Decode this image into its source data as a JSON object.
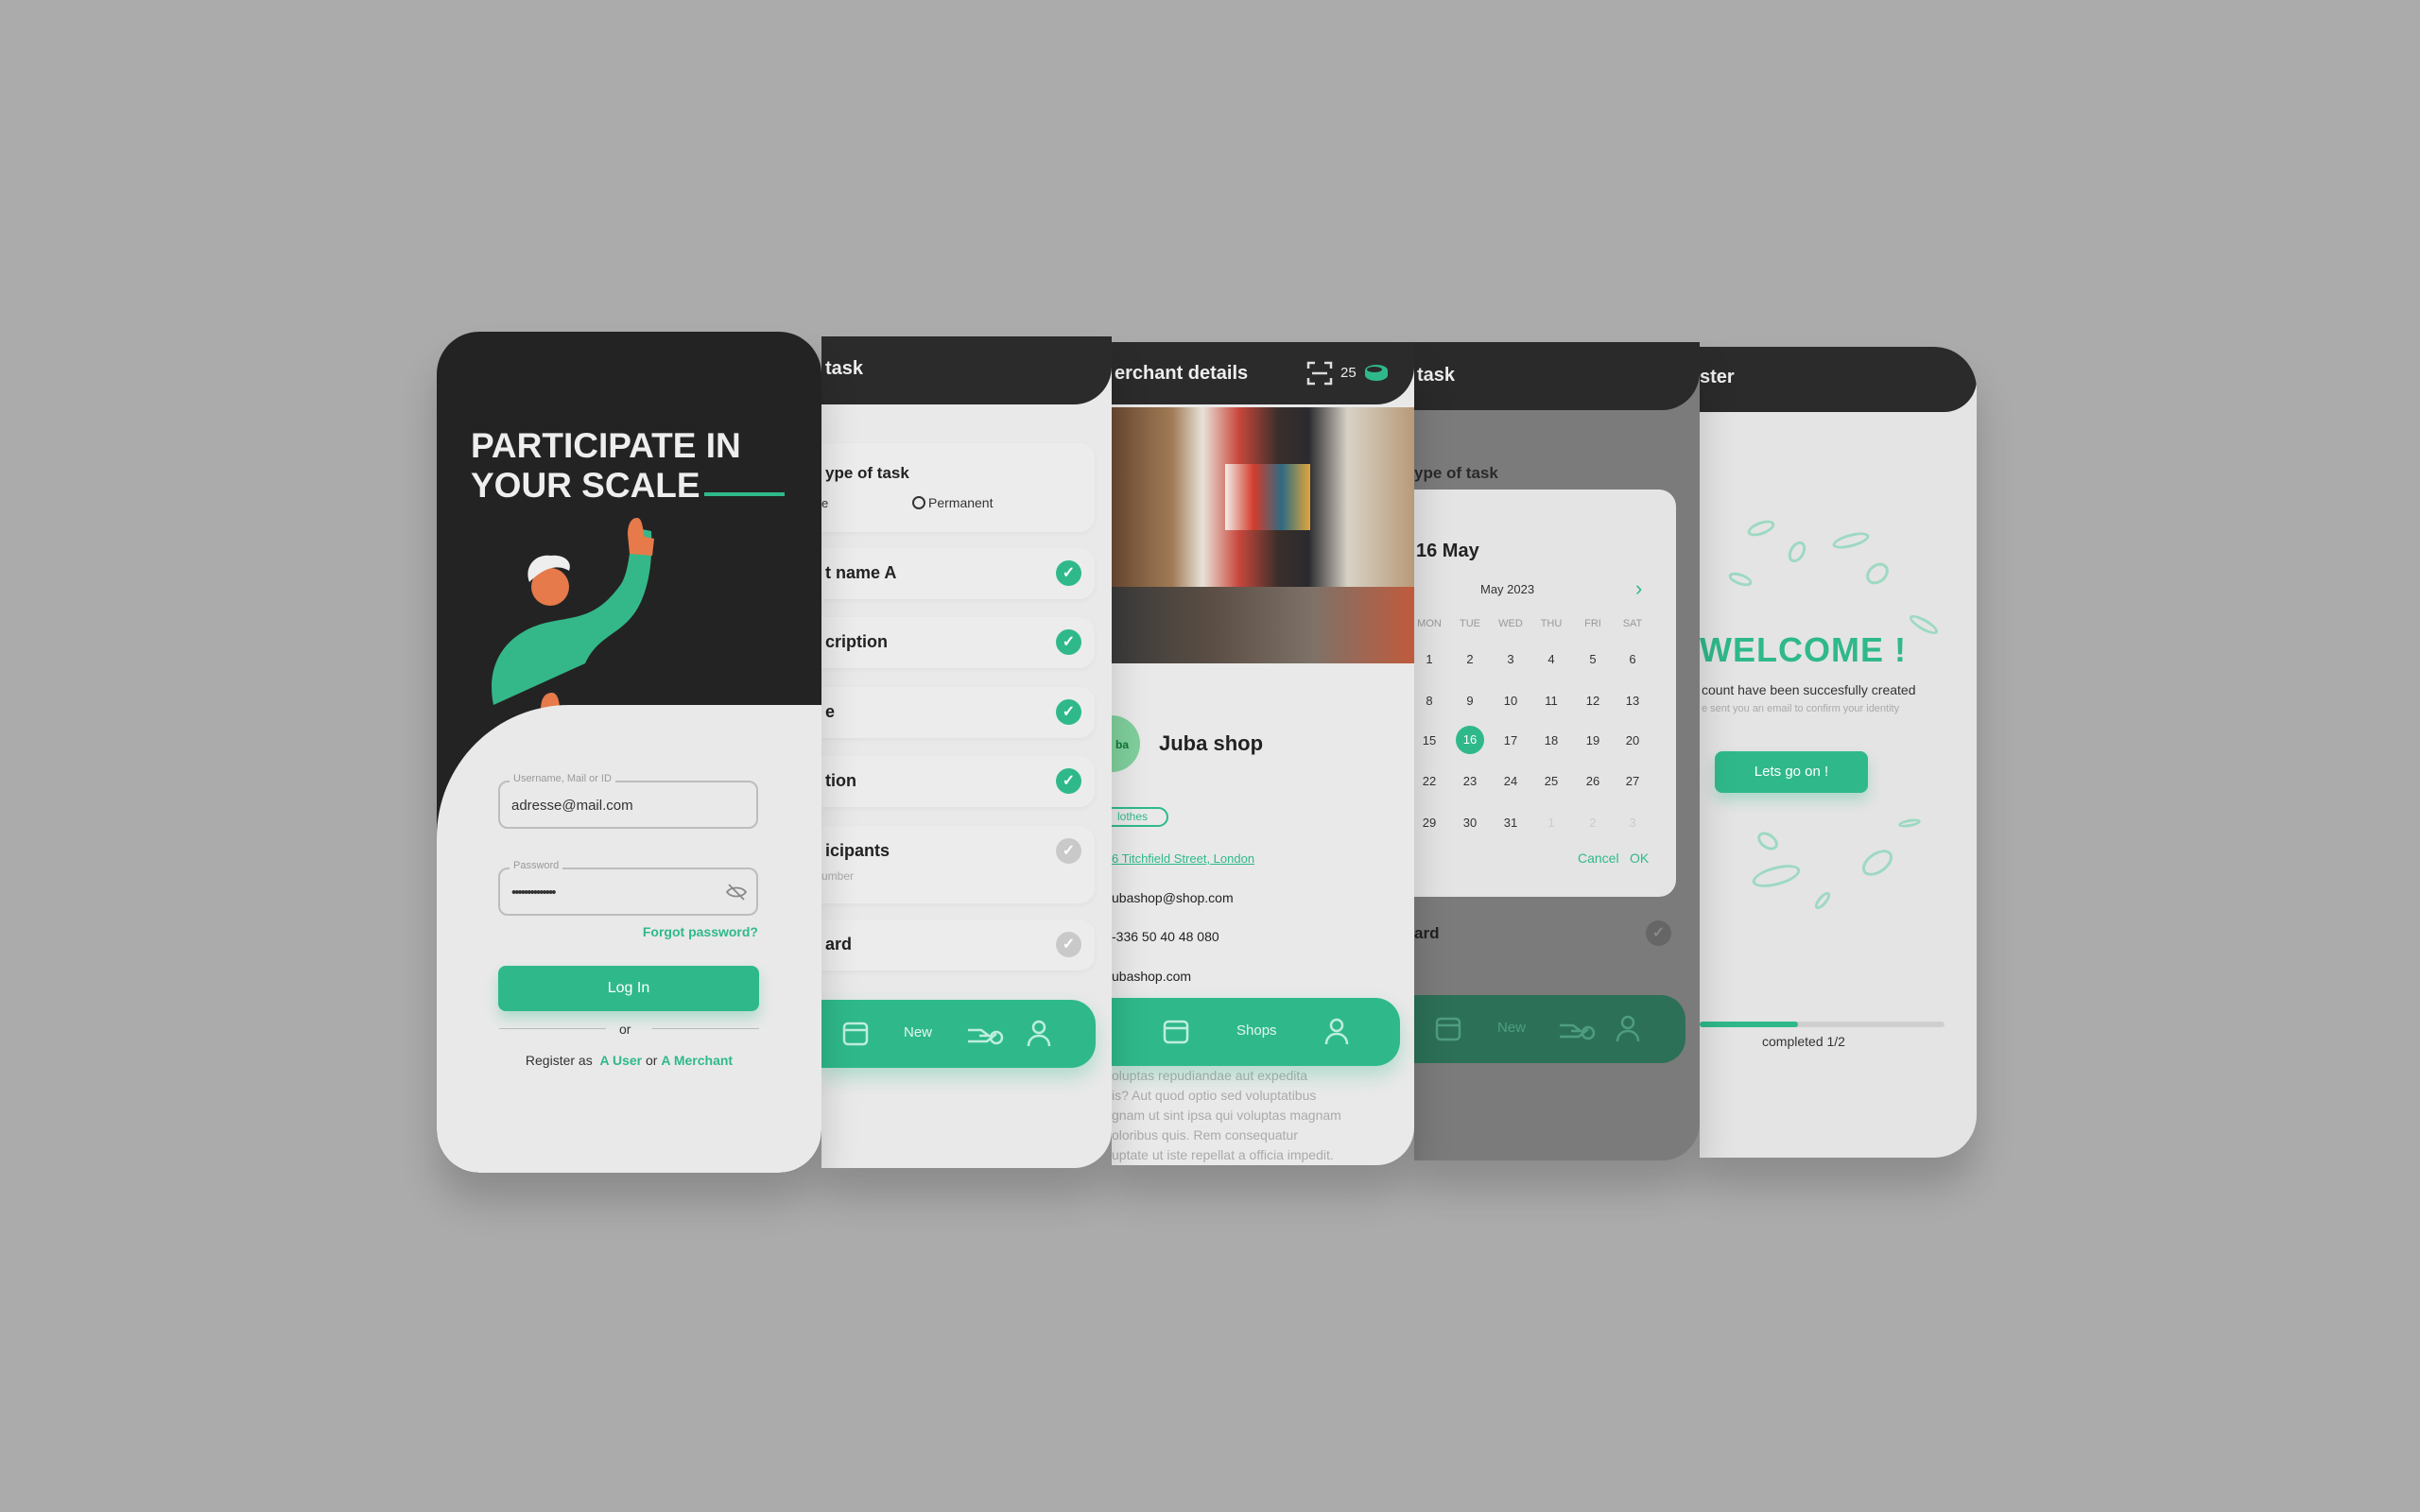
{
  "login": {
    "headline_1": "PARTICIPATE IN",
    "headline_2": "YOUR SCALE",
    "username_label": "Username, Mail or ID",
    "username_value": "adresse@mail.com",
    "password_label": "Password",
    "password_value": "••••••••••••••",
    "forgot": "Forgot password?",
    "login_button": "Log In",
    "or": "or",
    "register_prefix": "Register as",
    "register_user": "A User",
    "register_or": "or",
    "register_merchant": "A Merchant"
  },
  "task": {
    "title": "task",
    "type_label": "ype of task",
    "type_option_1": "e",
    "type_option_2": "Permanent",
    "rows": [
      {
        "label": "t name A",
        "done": true
      },
      {
        "label": "cription",
        "done": true
      },
      {
        "label": "e",
        "done": true
      },
      {
        "label": "tion",
        "done": true
      },
      {
        "label": "icipants",
        "sub": "umber",
        "done": false
      },
      {
        "label": "ard",
        "done": false
      }
    ],
    "nav_label": "New"
  },
  "merchant": {
    "title": "erchant details",
    "points": "25",
    "avatar_text": "ba",
    "name": "Juba shop",
    "tag": "lothes",
    "address": "6 Titchfield Street, London",
    "email": "ubashop@shop.com",
    "phone": "-336 50 40 48 080",
    "website": "ubashop.com",
    "nav_label": "Shops",
    "description": [
      "oluptas repudiandae aut expedita",
      "is? Aut quod optio sed voluptatibus",
      "gnam ut sint ipsa qui voluptas magnam",
      "oloribus quis. Rem consequatur",
      "uptate ut iste repellat a officia impedit."
    ]
  },
  "calendar": {
    "title": "task",
    "type_label": "ype of task",
    "selected_date": "16 May",
    "month": "May 2023",
    "weekdays": [
      "MON",
      "TUE",
      "WED",
      "THU",
      "FRI",
      "SAT"
    ],
    "weeks": [
      [
        "1",
        "2",
        "3",
        "4",
        "5",
        "6"
      ],
      [
        "8",
        "9",
        "10",
        "11",
        "12",
        "13"
      ],
      [
        "15",
        "16",
        "17",
        "18",
        "19",
        "20"
      ],
      [
        "22",
        "23",
        "24",
        "25",
        "26",
        "27"
      ],
      [
        "29",
        "30",
        "31",
        "1",
        "2",
        "3"
      ]
    ],
    "selected_day": "16",
    "cancel": "Cancel",
    "ok": "OK",
    "row_label": "ard",
    "nav_label": "New"
  },
  "welcome": {
    "title": "ster",
    "heading": "WELCOME !",
    "message": "count have been succesfully created",
    "sub_message": "e sent you an email to confirm your identity",
    "button": "Lets go on !",
    "progress_percent": 50,
    "progress_label": "completed 1/2"
  },
  "colors": {
    "accent": "#2fb98a",
    "dark": "#2b2b2b",
    "background": "#ababab"
  }
}
